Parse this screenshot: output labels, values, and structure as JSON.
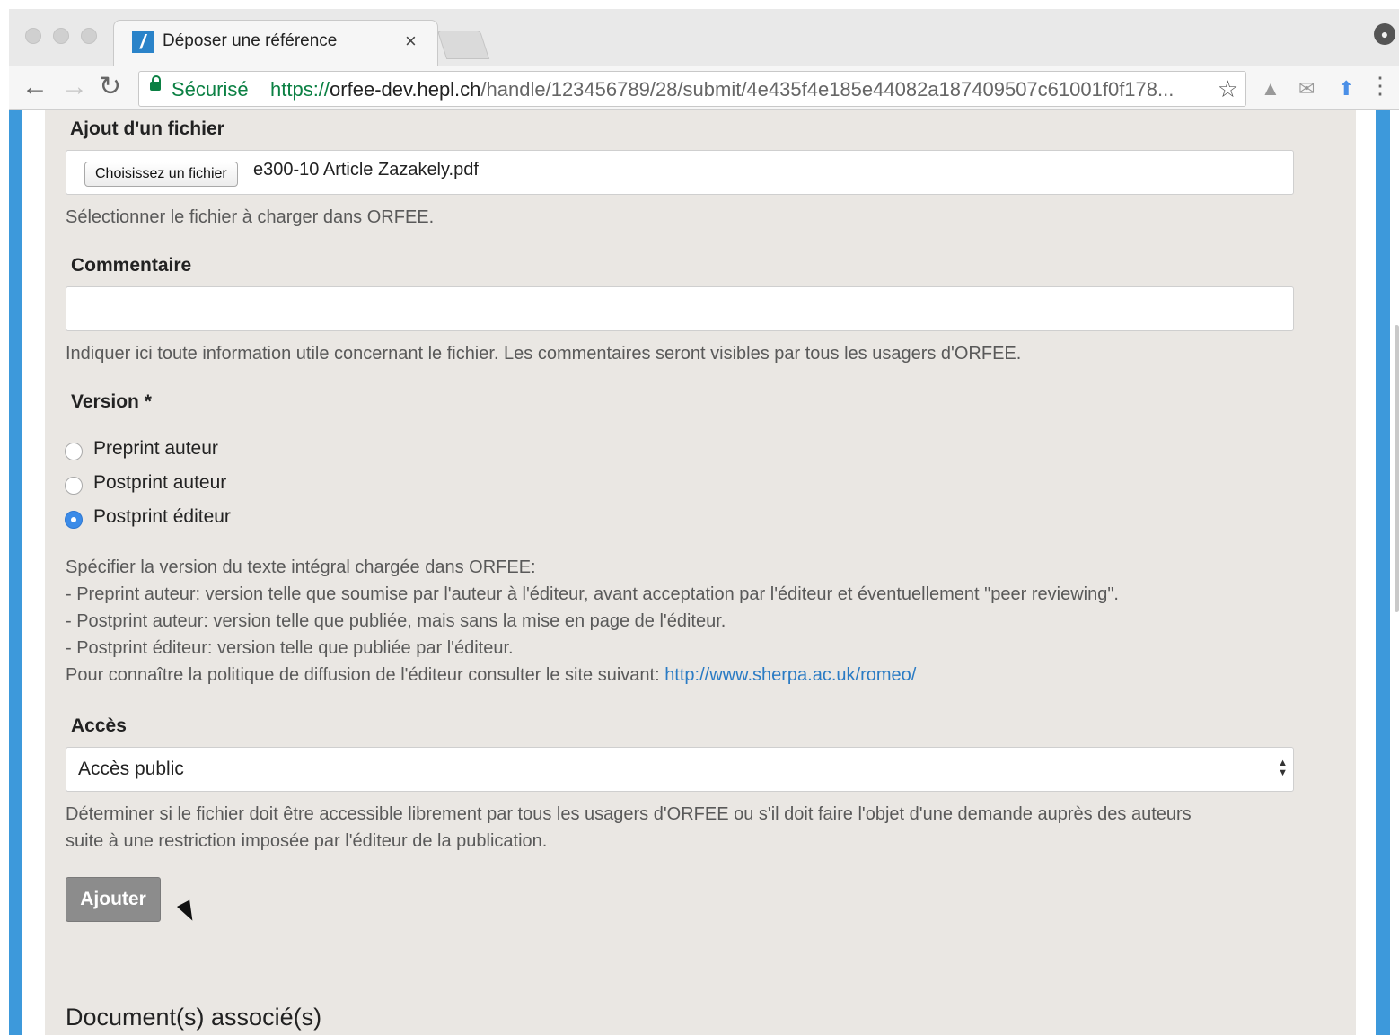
{
  "browser": {
    "tab_title": "Déposer une référence",
    "secure_label": "Sécurisé",
    "url_scheme": "https://",
    "url_host": "orfee-dev.hepl.ch",
    "url_path": "/handle/123456789/28/submit/4e435f4e185e44082a187409507c61001f0f178..."
  },
  "form": {
    "file": {
      "label": "Ajout d'un fichier",
      "button_label": "Choisissez un fichier",
      "filename": "e300-10 Article Zazakely.pdf",
      "help": "Sélectionner le fichier à charger dans ORFEE."
    },
    "comment": {
      "label": "Commentaire",
      "value": "",
      "help": "Indiquer ici toute information utile concernant le fichier. Les commentaires seront visibles par tous les usagers d'ORFEE."
    },
    "version": {
      "label": "Version *",
      "options": [
        {
          "label": "Preprint auteur",
          "checked": false
        },
        {
          "label": "Postprint auteur",
          "checked": false
        },
        {
          "label": "Postprint éditeur",
          "checked": true
        }
      ],
      "help_lines": [
        "Spécifier la version du texte intégral chargée dans ORFEE:",
        "- Preprint auteur: version telle que soumise par l'auteur à l'éditeur, avant acceptation par l'éditeur et éventuellement \"peer reviewing\".",
        "- Postprint auteur: version telle que publiée, mais sans la mise en page de l'éditeur.",
        "- Postprint éditeur: version telle que publiée par l'éditeur."
      ],
      "help_link_prefix": "Pour connaître la politique de diffusion de l'éditeur consulter le site suivant: ",
      "help_link": "http://www.sherpa.ac.uk/romeo/"
    },
    "access": {
      "label": "Accès",
      "selected": "Accès public",
      "help_lines": [
        "Déterminer si le fichier doit être accessible librement par tous les usagers d'ORFEE ou s'il doit faire l'objet d'une demande auprès des auteurs",
        "suite à une restriction imposée par l'éditeur de la publication."
      ]
    },
    "add_button": "Ajouter"
  },
  "section_title": "Document(s) associé(s)"
}
